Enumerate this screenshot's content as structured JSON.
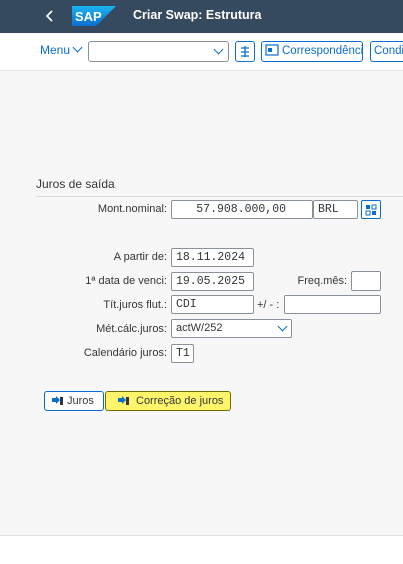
{
  "shell": {
    "title": "Criar Swap: Estrutura",
    "logo_text": "SAP",
    "colors": {
      "shell_bg": "#354a5f",
      "accent": "#0a6ed1",
      "highlight": "#fff56a"
    }
  },
  "toolbar": {
    "menu_label": "Menu",
    "command_value": "",
    "buttons": [
      {
        "label": "Correspondência",
        "icon": "correspondence-icon"
      },
      {
        "label": "Condi",
        "icon": ""
      }
    ]
  },
  "section": {
    "title": "Juros de saída"
  },
  "form": {
    "nominal_label": "Mont.nominal:",
    "nominal_value": "57.908.000,00",
    "currency_value": "BRL",
    "start_label": "A partir de:",
    "start_value": "18.11.2024",
    "first_due_label": "1ª data de venci:",
    "first_due_value": "19.05.2025",
    "freq_label": "Freq.mês:",
    "freq_value": "",
    "float_label": "Tít.juros flut.:",
    "float_value": "CDI",
    "spread_label": "+/ - :",
    "spread_value": "",
    "method_label": "Mét.cálc.juros:",
    "method_value": "actW/252",
    "calendar_label": "Calendário juros:",
    "calendar_value": "T1"
  },
  "actions": {
    "interest_label": "Juros",
    "correction_label": "Correção de juros"
  }
}
